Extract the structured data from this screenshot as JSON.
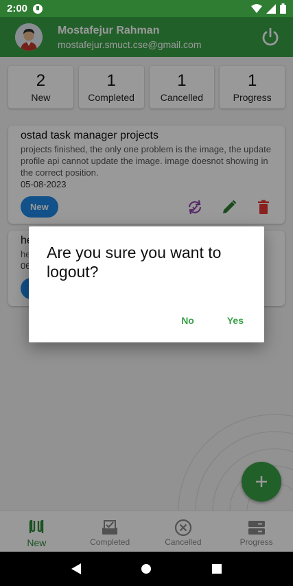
{
  "status_bar": {
    "time": "2:00"
  },
  "app_bar": {
    "user_name": "Mostafejur Rahman",
    "user_email": "mostafejur.smuct.cse@gmail.com"
  },
  "summary": [
    {
      "count": "2",
      "label": "New"
    },
    {
      "count": "1",
      "label": "Completed"
    },
    {
      "count": "1",
      "label": "Cancelled"
    },
    {
      "count": "1",
      "label": "Progress"
    }
  ],
  "tasks": [
    {
      "title": "ostad task manager projects",
      "description": "projects finished, the only one problem is the image, the update profile api cannot update the image. image doesnot showing in the correct position.",
      "date": "05-08-2023",
      "status": "New"
    },
    {
      "title": "he",
      "description": "he",
      "date": "06",
      "status": "New"
    }
  ],
  "bottom_nav": [
    {
      "label": "New",
      "icon": "new-tasks-icon",
      "active": true
    },
    {
      "label": "Completed",
      "icon": "completed-tasks-icon",
      "active": false
    },
    {
      "label": "Cancelled",
      "icon": "cancelled-tasks-icon",
      "active": false
    },
    {
      "label": "Progress",
      "icon": "progress-tasks-icon",
      "active": false
    }
  ],
  "dialog": {
    "title": "Are you sure you want to logout?",
    "no_label": "No",
    "yes_label": "Yes"
  },
  "colors": {
    "primary": "#3aa047",
    "status_bar": "#2e7d32",
    "chip": "#1e88e5",
    "delete": "#e53935",
    "sync": "#8e44ad"
  }
}
